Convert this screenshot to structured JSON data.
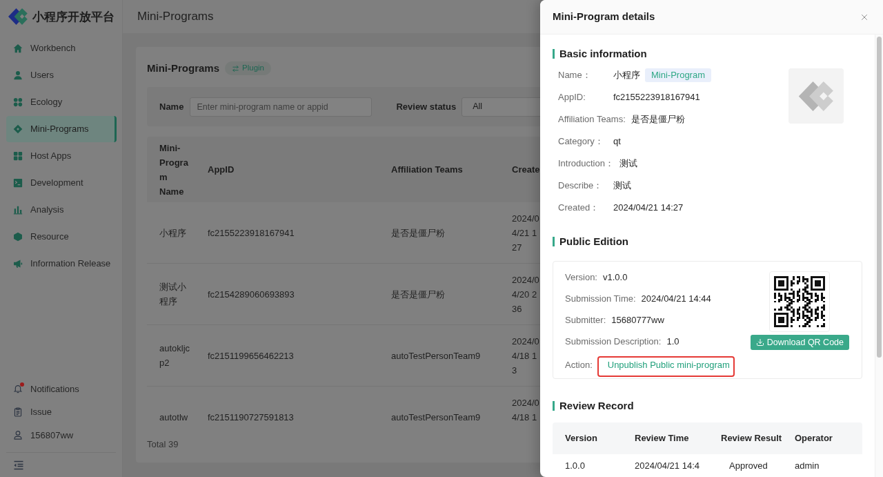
{
  "brand": {
    "name": "小程序开放平台"
  },
  "header": {
    "title": "Mini-Programs"
  },
  "sidebar": {
    "items": [
      {
        "label": "Workbench",
        "selected": false
      },
      {
        "label": "Users",
        "selected": false
      },
      {
        "label": "Ecology",
        "selected": false
      },
      {
        "label": "Mini-Programs",
        "selected": true
      },
      {
        "label": "Host Apps",
        "selected": false
      },
      {
        "label": "Development",
        "selected": false
      },
      {
        "label": "Analysis",
        "selected": false
      },
      {
        "label": "Resource",
        "selected": false
      },
      {
        "label": "Information Release",
        "selected": false
      }
    ],
    "footer": [
      {
        "label": "Notifications",
        "unread": true
      },
      {
        "label": "Issue",
        "unread": false
      },
      {
        "label": "156807ww",
        "unread": false
      }
    ]
  },
  "page": {
    "title": "Mini-Programs",
    "tag": "Plugin",
    "filters": [
      {
        "kind": "input",
        "label": "Name",
        "placeholder": "Enter mini-program name or appid"
      },
      {
        "kind": "select",
        "label": "Review status",
        "value": "All"
      }
    ],
    "table": {
      "columns": [
        "Mini-Program Name",
        "AppID",
        "Affiliation Teams",
        "Create"
      ],
      "rows": [
        {
          "name": "小程序",
          "appid": "fc2155223918167941",
          "team": "是否是僵尸粉",
          "created": "2024/0\n4/21 1\n27"
        },
        {
          "name": "测试小程序",
          "appid": "fc2154289060693893",
          "team": "是否是僵尸粉",
          "created": "2024/0\n4/20 2\n36"
        },
        {
          "name": "autokljcp2",
          "appid": "fc2151199656462213",
          "team": "autoTestPersonTeam9",
          "created": "2024/0\n4/18 1\n3"
        },
        {
          "name": "autotlw",
          "appid": "fc2151190727591813",
          "team": "autoTestPersonTeam9",
          "created": "2024/0\n4/18 1"
        }
      ]
    },
    "total": "Total 39"
  },
  "drawer": {
    "title": "Mini-Program details",
    "basic": {
      "title": "Basic information",
      "fields": [
        {
          "label": "Name：",
          "value": "小程序",
          "tag": "Mini-Program"
        },
        {
          "label": "AppID:",
          "value": "fc2155223918167941"
        },
        {
          "label": "Affiliation Teams:",
          "value": "是否是僵尸粉"
        },
        {
          "label": "Category：",
          "value": "qt"
        },
        {
          "label": "Introduction：",
          "value": "测试"
        },
        {
          "label": "Describe：",
          "value": "测试"
        },
        {
          "label": "Created：",
          "value": "2024/04/21 14:27"
        }
      ]
    },
    "public_edition": {
      "title": "Public Edition",
      "fields": [
        {
          "label": "Version:",
          "value": "v1.0.0"
        },
        {
          "label": "Submission Time:",
          "value": "2024/04/21 14:44"
        },
        {
          "label": "Submitter:",
          "value": "15680777ww"
        },
        {
          "label": "Submission Description:",
          "value": "1.0"
        }
      ],
      "action": {
        "label": "Action:",
        "link": "Unpublish Public mini-program",
        "highlighted": true
      },
      "download_button": "Download QR Code"
    },
    "review_record": {
      "title": "Review Record",
      "columns": [
        "Version",
        "Review Time",
        "Review Result",
        "Operator"
      ],
      "rows": [
        {
          "version": "1.0.0",
          "review_time": "2024/04/21 14:4",
          "result": "Approved",
          "operator": "admin"
        }
      ]
    }
  }
}
